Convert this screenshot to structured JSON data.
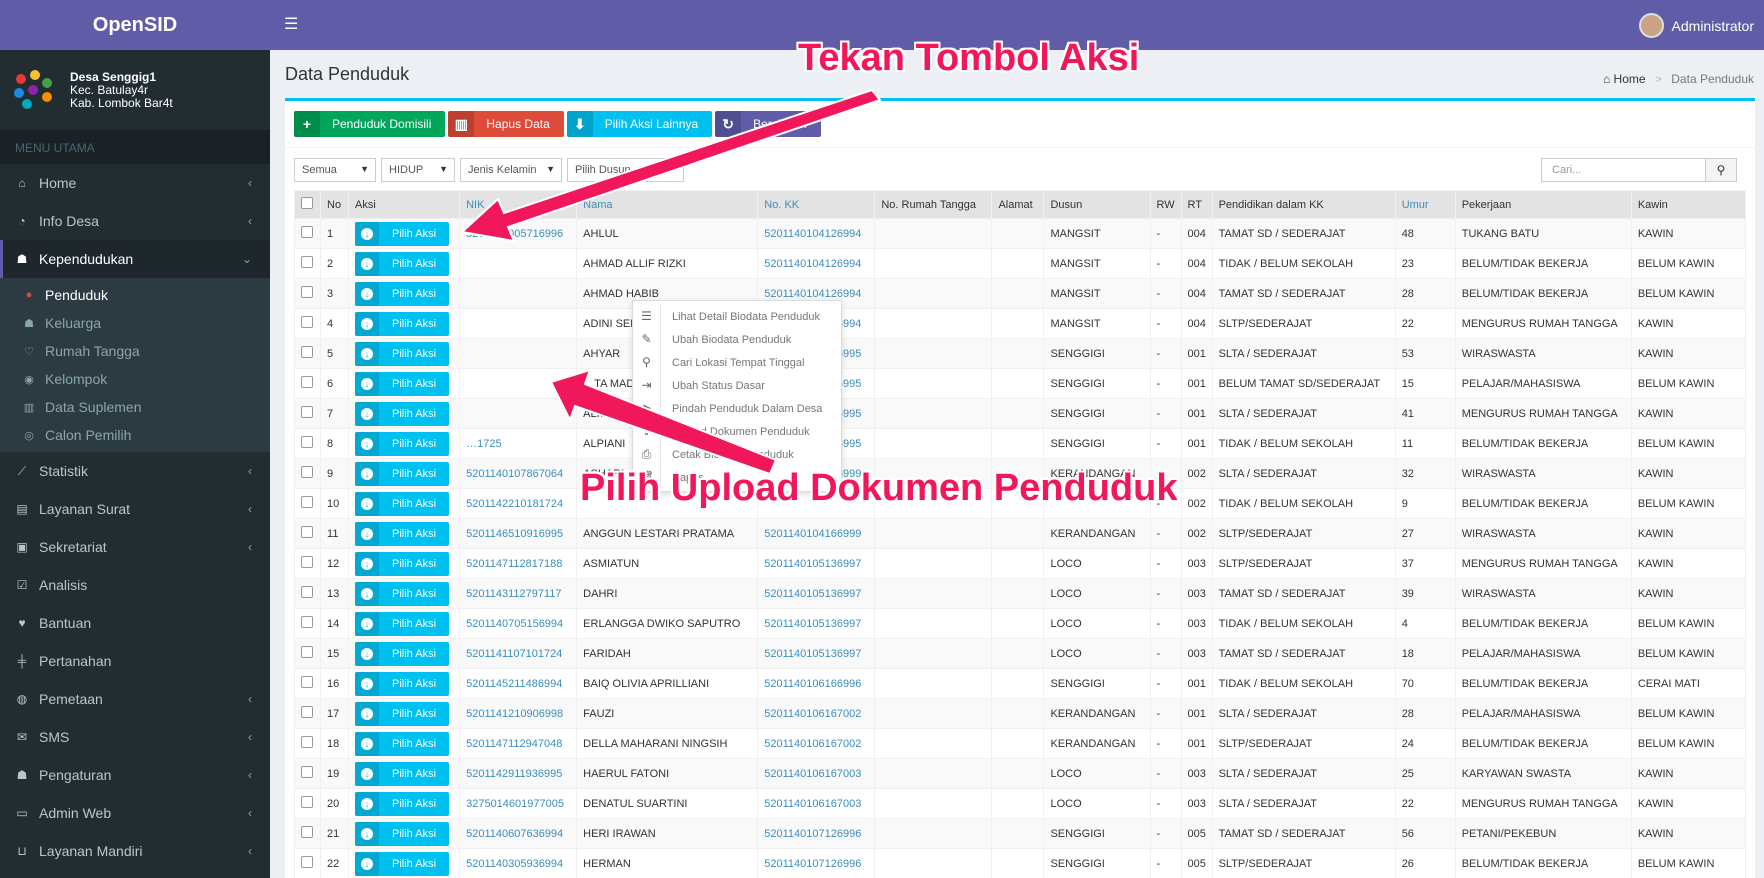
{
  "app": {
    "title": "OpenSID"
  },
  "village": {
    "name": "Desa Senggig1",
    "district": "Kec. Batulay4r",
    "regency": "Kab. Lombok Bar4t"
  },
  "menu_header": "MENU UTAMA",
  "nav": [
    {
      "label": "Home",
      "icon": "home-icon",
      "glyph": "⌂",
      "chev": "‹"
    },
    {
      "label": "Info Desa",
      "icon": "dashboard-icon",
      "glyph": "◔",
      "chev": "‹"
    },
    {
      "label": "Kependudukan",
      "icon": "users-icon",
      "glyph": "☗",
      "chev": "⌄",
      "active": true
    },
    {
      "label": "Statistik",
      "icon": "line-chart-icon",
      "glyph": "⟋",
      "chev": "‹"
    },
    {
      "label": "Layanan Surat",
      "icon": "book-icon",
      "glyph": "▤",
      "chev": "‹"
    },
    {
      "label": "Sekretariat",
      "icon": "archive-icon",
      "glyph": "▣",
      "chev": "‹"
    },
    {
      "label": "Analisis",
      "icon": "check-square-icon",
      "glyph": "☑",
      "chev": ""
    },
    {
      "label": "Bantuan",
      "icon": "heart-icon",
      "glyph": "♥",
      "chev": ""
    },
    {
      "label": "Pertanahan",
      "icon": "map-signs-icon",
      "glyph": "╪",
      "chev": ""
    },
    {
      "label": "Pemetaan",
      "icon": "globe-icon",
      "glyph": "◍",
      "chev": "‹"
    },
    {
      "label": "SMS",
      "icon": "envelope-icon",
      "glyph": "✉",
      "chev": "‹"
    },
    {
      "label": "Pengaturan",
      "icon": "users-cog-icon",
      "glyph": "☗",
      "chev": "‹"
    },
    {
      "label": "Admin Web",
      "icon": "desktop-icon",
      "glyph": "▭",
      "chev": "‹"
    },
    {
      "label": "Layanan Mandiri",
      "icon": "inbox-icon",
      "glyph": "⊔",
      "chev": "‹"
    }
  ],
  "subnav": [
    {
      "label": "Penduduk",
      "icon": "user-icon",
      "glyph": "●",
      "active": true
    },
    {
      "label": "Keluarga",
      "icon": "users-icon",
      "glyph": "☗"
    },
    {
      "label": "Rumah Tangga",
      "icon": "handshake-icon",
      "glyph": "♡"
    },
    {
      "label": "Kelompok",
      "icon": "group-icon",
      "glyph": "◉"
    },
    {
      "label": "Data Suplemen",
      "icon": "building-icon",
      "glyph": "▥"
    },
    {
      "label": "Calon Pemilih",
      "icon": "vote-icon",
      "glyph": "◎"
    }
  ],
  "header": {
    "user": "Administrator"
  },
  "page": {
    "title": "Data Penduduk"
  },
  "breadcrumb": {
    "home": "Home",
    "current": "Data Penduduk"
  },
  "toolbar": {
    "domisili": "Penduduk Domisili",
    "hapus": "Hapus Data",
    "aksi_lainnya": "Pilih Aksi Lainnya",
    "bersihkan": "Bersihkan"
  },
  "filters": {
    "status": "Semua",
    "hidup": "HIDUP",
    "jk": "Jenis Kelamin",
    "dusun": "Pilih Dusun"
  },
  "search": {
    "placeholder": "Cari..."
  },
  "columns": [
    "No",
    "Aksi",
    "NIK",
    "Nama",
    "No. KK",
    "No. Rumah Tangga",
    "Alamat",
    "Dusun",
    "RW",
    "RT",
    "Pendidikan dalam KK",
    "Umur",
    "Pekerjaan",
    "Kawin"
  ],
  "pilih_label": "Pilih Aksi",
  "rows": [
    [
      "1",
      "5201142005716996",
      "AHLUL",
      "5201140104126994",
      "",
      "",
      "MANGSIT",
      "-",
      "004",
      "TAMAT SD / SEDERAJAT",
      "48",
      "TUKANG BATU",
      "KAWIN"
    ],
    [
      "2",
      "",
      "AHMAD ALLIF RIZKI",
      "5201140104126994",
      "",
      "",
      "MANGSIT",
      "-",
      "004",
      "TIDAK / BELUM SEKOLAH",
      "23",
      "BELUM/TIDAK BEKERJA",
      "BELUM KAWIN"
    ],
    [
      "3",
      "",
      "AHMAD HABIB",
      "5201140104126994",
      "",
      "",
      "MANGSIT",
      "-",
      "004",
      "TAMAT SD / SEDERAJAT",
      "28",
      "BELUM/TIDAK BEKERJA",
      "BELUM KAWIN"
    ],
    [
      "4",
      "",
      "ADINI SEPTIA LISTA",
      "5201140104126994",
      "",
      "",
      "MANGSIT",
      "-",
      "004",
      "SLTP/SEDERAJAT",
      "22",
      "MENGURUS RUMAH TANGGA",
      "KAWIN"
    ],
    [
      "5",
      "",
      "AHYAR",
      "5201140104126995",
      "",
      "",
      "SENGGIGI",
      "-",
      "001",
      "SLTA / SEDERAJAT",
      "53",
      "WIRASWASTA",
      "KAWIN"
    ],
    [
      "6",
      "",
      "…TA MADA RIZKY ALAMSYAH",
      "5201140104126995",
      "",
      "",
      "SENGGIGI",
      "-",
      "001",
      "BELUM TAMAT SD/SEDERAJAT",
      "15",
      "PELAJAR/MAHASISWA",
      "BELUM KAWIN"
    ],
    [
      "7",
      "",
      "ALI…",
      "5201140104126995",
      "",
      "",
      "SENGGIGI",
      "-",
      "001",
      "SLTA / SEDERAJAT",
      "41",
      "MENGURUS RUMAH TANGGA",
      "KAWIN"
    ],
    [
      "8",
      "…1725",
      "ALPIANI",
      "5201140104126995",
      "",
      "",
      "SENGGIGI",
      "-",
      "001",
      "TIDAK / BELUM SEKOLAH",
      "11",
      "BELUM/TIDAK BEKERJA",
      "BELUM KAWIN"
    ],
    [
      "9",
      "5201140107867064",
      "ASHARI",
      "5201140104166999",
      "",
      "",
      "KERANDANGAN",
      "-",
      "002",
      "SLTA / SEDERAJAT",
      "32",
      "WIRASWASTA",
      "KAWIN"
    ],
    [
      "10",
      "5201142210181724",
      "",
      "",
      "",
      "",
      "",
      "-",
      "002",
      "TIDAK / BELUM SEKOLAH",
      "9",
      "BELUM/TIDAK BEKERJA",
      "BELUM KAWIN"
    ],
    [
      "11",
      "5201146510916995",
      "ANGGUN LESTARI PRATAMA",
      "5201140104166999",
      "",
      "",
      "KERANDANGAN",
      "-",
      "002",
      "SLTP/SEDERAJAT",
      "27",
      "WIRASWASTA",
      "KAWIN"
    ],
    [
      "12",
      "5201147112817188",
      "ASMIATUN",
      "5201140105136997",
      "",
      "",
      "LOCO",
      "-",
      "003",
      "SLTP/SEDERAJAT",
      "37",
      "MENGURUS RUMAH TANGGA",
      "KAWIN"
    ],
    [
      "13",
      "5201143112797117",
      "DAHRI",
      "5201140105136997",
      "",
      "",
      "LOCO",
      "-",
      "003",
      "TAMAT SD / SEDERAJAT",
      "39",
      "WIRASWASTA",
      "KAWIN"
    ],
    [
      "14",
      "5201140705156994",
      "ERLANGGA DWIKO SAPUTRO",
      "5201140105136997",
      "",
      "",
      "LOCO",
      "-",
      "003",
      "TIDAK / BELUM SEKOLAH",
      "4",
      "BELUM/TIDAK BEKERJA",
      "BELUM KAWIN"
    ],
    [
      "15",
      "5201141107101724",
      "FARIDAH",
      "5201140105136997",
      "",
      "",
      "LOCO",
      "-",
      "003",
      "TAMAT SD / SEDERAJAT",
      "18",
      "PELAJAR/MAHASISWA",
      "BELUM KAWIN"
    ],
    [
      "16",
      "5201145211486994",
      "BAIQ OLIVIA APRILLIANI",
      "5201140106166996",
      "",
      "",
      "SENGGIGI",
      "-",
      "001",
      "TIDAK / BELUM SEKOLAH",
      "70",
      "BELUM/TIDAK BEKERJA",
      "CERAI MATI"
    ],
    [
      "17",
      "5201141210906998",
      "FAUZI",
      "5201140106167002",
      "",
      "",
      "KERANDANGAN",
      "-",
      "001",
      "SLTA / SEDERAJAT",
      "28",
      "PELAJAR/MAHASISWA",
      "BELUM KAWIN"
    ],
    [
      "18",
      "5201147112947048",
      "DELLA MAHARANI NINGSIH",
      "5201140106167002",
      "",
      "",
      "KERANDANGAN",
      "-",
      "001",
      "SLTP/SEDERAJAT",
      "24",
      "BELUM/TIDAK BEKERJA",
      "BELUM KAWIN"
    ],
    [
      "19",
      "5201142911936995",
      "HAERUL FATONI",
      "5201140106167003",
      "",
      "",
      "LOCO",
      "-",
      "003",
      "SLTA / SEDERAJAT",
      "25",
      "KARYAWAN SWASTA",
      "KAWIN"
    ],
    [
      "20",
      "3275014601977005",
      "DENATUL SUARTINI",
      "5201140106167003",
      "",
      "",
      "LOCO",
      "-",
      "003",
      "SLTA / SEDERAJAT",
      "22",
      "MENGURUS RUMAH TANGGA",
      "KAWIN"
    ],
    [
      "21",
      "5201140607636994",
      "HERI IRAWAN",
      "5201140107126996",
      "",
      "",
      "SENGGIGI",
      "-",
      "005",
      "TAMAT SD / SEDERAJAT",
      "56",
      "PETANI/PEKEBUN",
      "KAWIN"
    ],
    [
      "22",
      "5201140305936994",
      "HERMAN",
      "5201140107126996",
      "",
      "",
      "SENGGIGI",
      "-",
      "005",
      "SLTP/SEDERAJAT",
      "26",
      "BELUM/TIDAK BEKERJA",
      "BELUM KAWIN"
    ]
  ],
  "dropdown": [
    {
      "label": "Lihat Detail Biodata Penduduk",
      "icon": "list-icon",
      "glyph": "☰"
    },
    {
      "label": "Ubah Biodata Penduduk",
      "icon": "edit-icon",
      "glyph": "✎"
    },
    {
      "label": "Cari Lokasi Tempat Tinggal",
      "icon": "map-marker-icon",
      "glyph": "⚲"
    },
    {
      "label": "Ubah Status Dasar",
      "icon": "sign-out-icon",
      "glyph": "⇥"
    },
    {
      "label": "Pindah Penduduk Dalam Desa",
      "icon": "location-arrow-icon",
      "glyph": "➤"
    },
    {
      "label": "Upload Dokumen Penduduk",
      "icon": "upload-icon",
      "glyph": "⇪"
    },
    {
      "label": "Cetak Biodata Penduduk",
      "icon": "print-icon",
      "glyph": "⎙"
    },
    {
      "label": "Hapus",
      "icon": "trash-icon",
      "glyph": "🗑"
    }
  ],
  "annotations": {
    "top": "Tekan Tombol Aksi",
    "bottom": "Pilih Upload Dokumen Penduduk"
  },
  "colors": {
    "brand": "#605ca8",
    "accent": "#00c0ef",
    "success": "#00a65a",
    "danger": "#dd4b39",
    "annotation": "#f0185a"
  }
}
